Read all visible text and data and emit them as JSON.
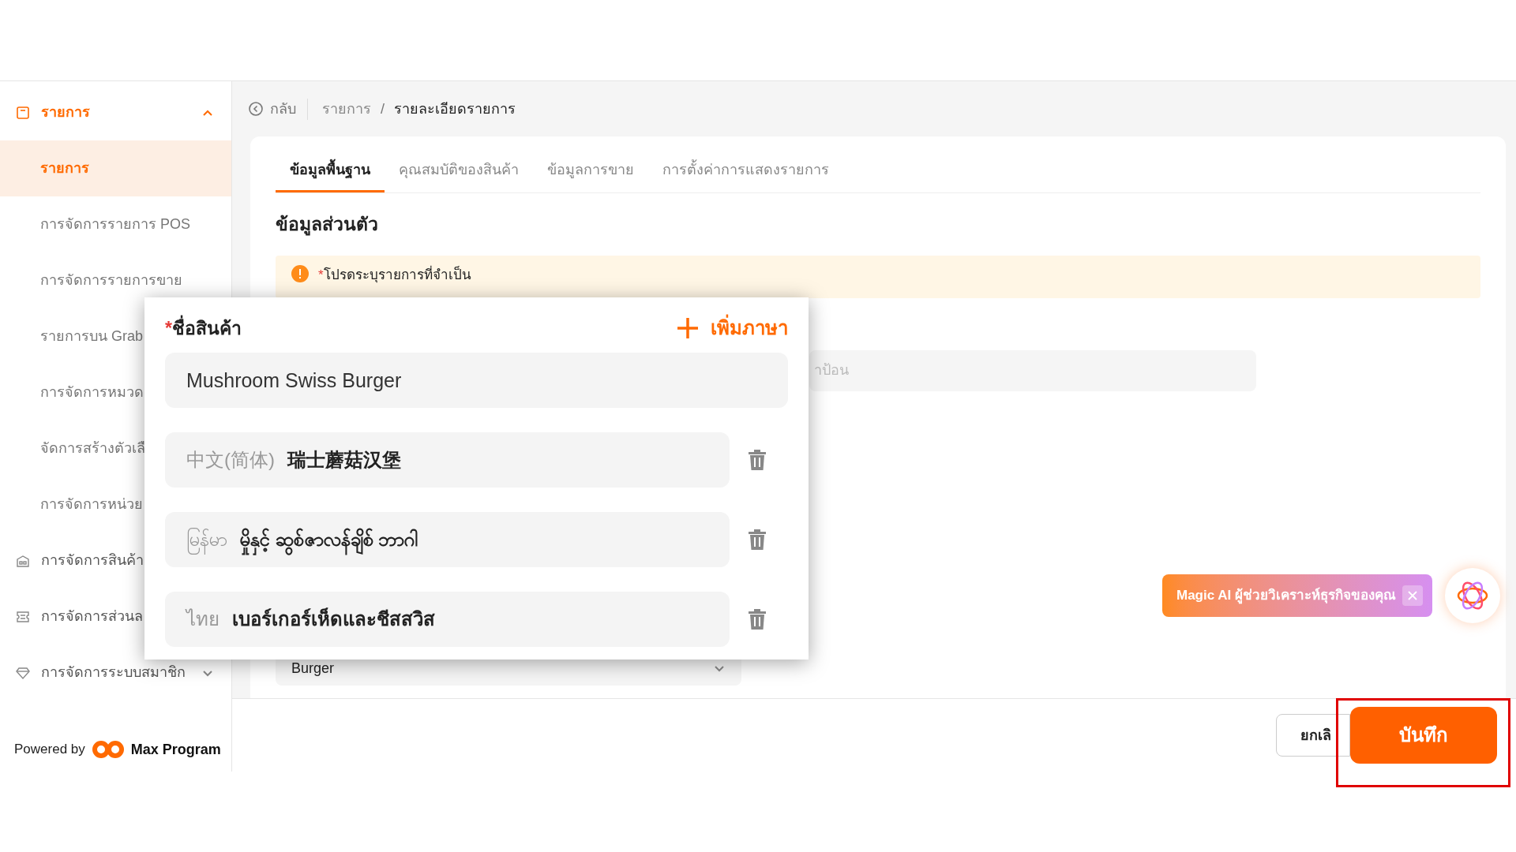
{
  "sidebar": {
    "items": [
      {
        "label": "รายการ",
        "expanded": true,
        "children": [
          {
            "label": "รายการ",
            "selected": true
          },
          {
            "label": "การจัดการรายการ POS",
            "selected": false
          },
          {
            "label": "การจัดการรายการขาย",
            "selected": false
          },
          {
            "label": "รายการบน Grab",
            "selected": false
          },
          {
            "label": "การจัดการหมวด",
            "selected": false
          },
          {
            "label": "จัดการสร้างตัวเลื",
            "selected": false
          },
          {
            "label": "การจัดการหน่วย",
            "selected": false
          }
        ]
      },
      {
        "label": "การจัดการสินค้า"
      },
      {
        "label": "การจัดการส่วนล"
      },
      {
        "label": "การจัดการระบบสมาชิก",
        "expanded": false
      }
    ],
    "footer": {
      "prefix": "Powered by",
      "brand": "Max Program"
    }
  },
  "breadcrumb": {
    "back": "กลับ",
    "separator": "/",
    "items": [
      "รายการ",
      "รายละเอียดรายการ"
    ]
  },
  "tabs": [
    {
      "label": "ข้อมูลพื้นฐาน",
      "selected": true
    },
    {
      "label": "คุณสมบัติของสินค้า",
      "selected": false
    },
    {
      "label": "ข้อมูลการขาย",
      "selected": false
    },
    {
      "label": "การตั้งค่าการแสดงรายการ",
      "selected": false
    }
  ],
  "section_title": "ข้อมูลส่วนตัว",
  "notice": {
    "mark": "*",
    "text": "โปรดระบุรายการที่จำเป็น"
  },
  "hidden_field": {
    "placeholder": "าป้อน"
  },
  "category_select": {
    "value": "Burger"
  },
  "name_popup": {
    "mark": "*",
    "label": "ชื่อสินค้า",
    "add_language": "เพิ่มภาษา",
    "value": "Mushroom Swiss Burger",
    "translations": [
      {
        "language": "中文(简体)",
        "value": "瑞士蘑菇汉堡"
      },
      {
        "language": "မြန်မာ",
        "value": "မှိုနှင့် ဆွစ်ဇာလန်ချိစ် ဘာဂါ"
      },
      {
        "language": "ไทย",
        "value": "เบอร์เกอร์เห็ดและชีสสวิส"
      }
    ]
  },
  "magic_ai": {
    "text": "Magic AI ผู้ช่วยวิเคราะห์ธุรกิจของคุณ"
  },
  "footer": {
    "cancel": "ยกเลิ",
    "save": "บันทึก",
    "save_highlighted": true
  }
}
